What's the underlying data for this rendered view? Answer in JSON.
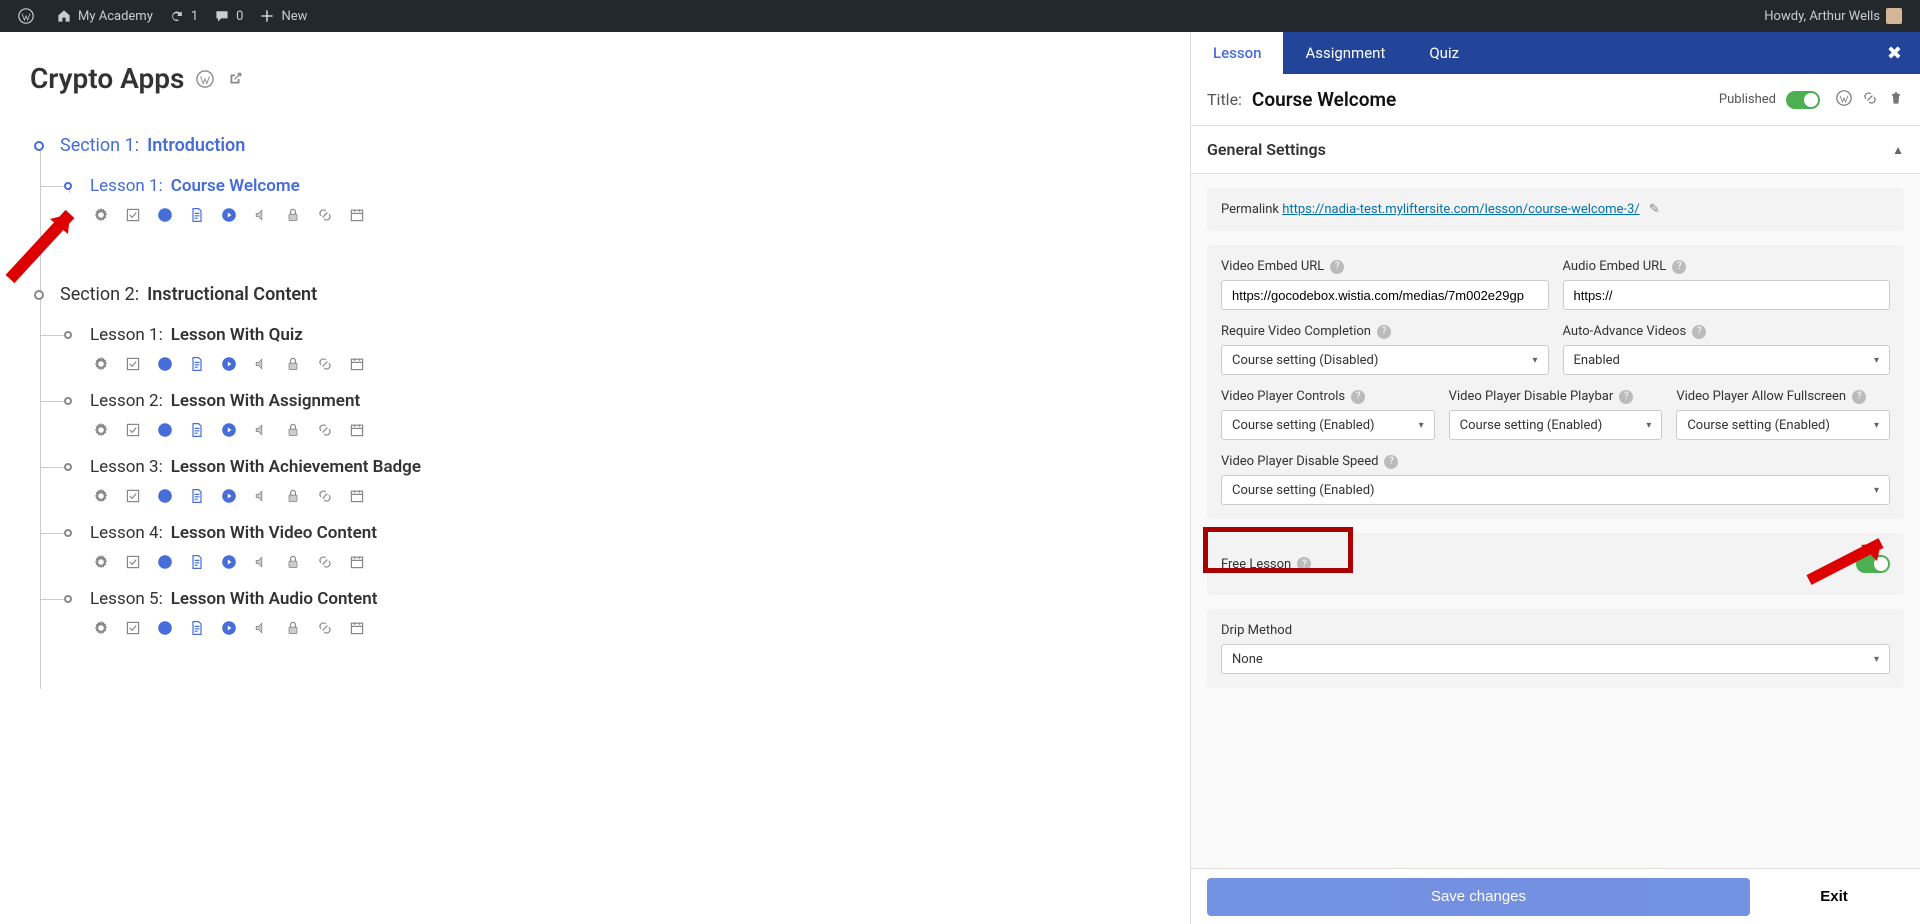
{
  "adminbar": {
    "site": "My Academy",
    "updates": "1",
    "comments": "0",
    "new": "New",
    "howdy": "Howdy, Arthur Wells"
  },
  "course": {
    "title": "Crypto Apps"
  },
  "sections": [
    {
      "num": "Section 1:",
      "name": "Introduction",
      "active": true,
      "lessons": [
        {
          "num": "Lesson 1:",
          "name": "Course Welcome",
          "active": true
        }
      ]
    },
    {
      "num": "Section 2:",
      "name": "Instructional Content",
      "active": false,
      "lessons": [
        {
          "num": "Lesson 1:",
          "name": "Lesson With Quiz"
        },
        {
          "num": "Lesson 2:",
          "name": "Lesson With Assignment"
        },
        {
          "num": "Lesson 3:",
          "name": "Lesson With Achievement Badge"
        },
        {
          "num": "Lesson 4:",
          "name": "Lesson With Video Content"
        },
        {
          "num": "Lesson 5:",
          "name": "Lesson With Audio Content"
        }
      ]
    }
  ],
  "editor": {
    "tabs": [
      "Lesson",
      "Assignment",
      "Quiz"
    ],
    "activeTab": 0,
    "titleLabel": "Title:",
    "titleValue": "Course Welcome",
    "publishedLabel": "Published",
    "panelTitle": "General Settings",
    "permalinkLabel": "Permalink",
    "permalink": "https://nadia-test.myliftersite.com/lesson/course-welcome-3/",
    "fields": {
      "videoEmbed": {
        "label": "Video Embed URL",
        "value": "https://gocodebox.wistia.com/medias/7m002e29gp"
      },
      "audioEmbed": {
        "label": "Audio Embed URL",
        "value": "https://"
      },
      "requireVideo": {
        "label": "Require Video Completion",
        "value": "Course setting (Disabled)"
      },
      "autoAdvance": {
        "label": "Auto-Advance Videos",
        "value": "Enabled"
      },
      "playerControls": {
        "label": "Video Player Controls",
        "value": "Course setting (Enabled)"
      },
      "disablePlaybar": {
        "label": "Video Player Disable Playbar",
        "value": "Course setting (Enabled)"
      },
      "allowFullscreen": {
        "label": "Video Player Allow Fullscreen",
        "value": "Course setting (Enabled)"
      },
      "disableSpeed": {
        "label": "Video Player Disable Speed",
        "value": "Course setting (Enabled)"
      },
      "freeLesson": {
        "label": "Free Lesson"
      },
      "dripMethod": {
        "label": "Drip Method",
        "value": "None"
      }
    },
    "saveLabel": "Save changes",
    "exitLabel": "Exit"
  }
}
